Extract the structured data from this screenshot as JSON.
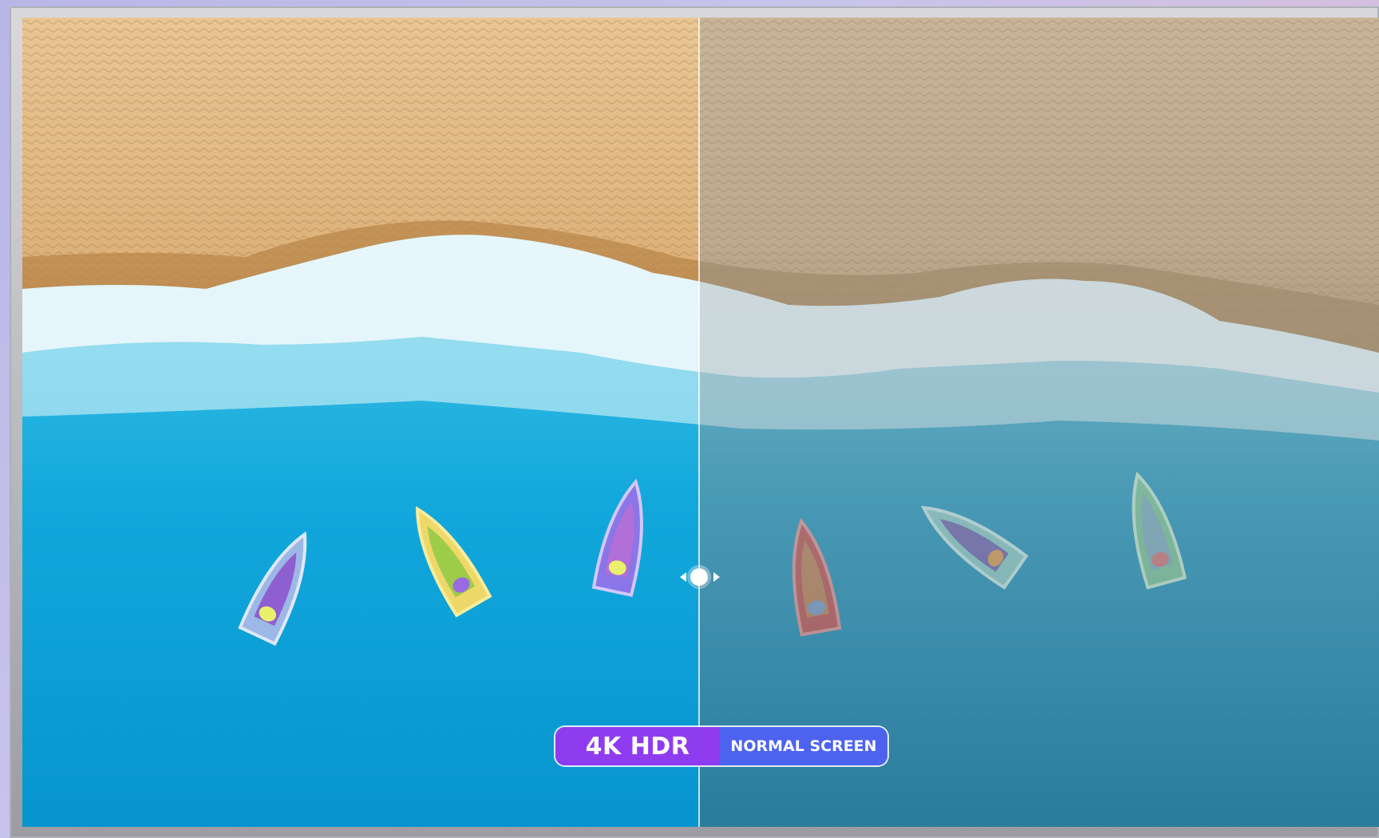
{
  "comparison": {
    "left_label": "4K HDR",
    "right_label": "NORMAL SCREEN"
  },
  "colors": {
    "hdr_badge": "#8f3cf0",
    "normal_badge": "#4d63f0",
    "sand": "#e2b77c",
    "sea": "#0aa3d8"
  },
  "icons": [
    "slider-handle-icon",
    "arrow-left-icon",
    "arrow-right-icon"
  ]
}
